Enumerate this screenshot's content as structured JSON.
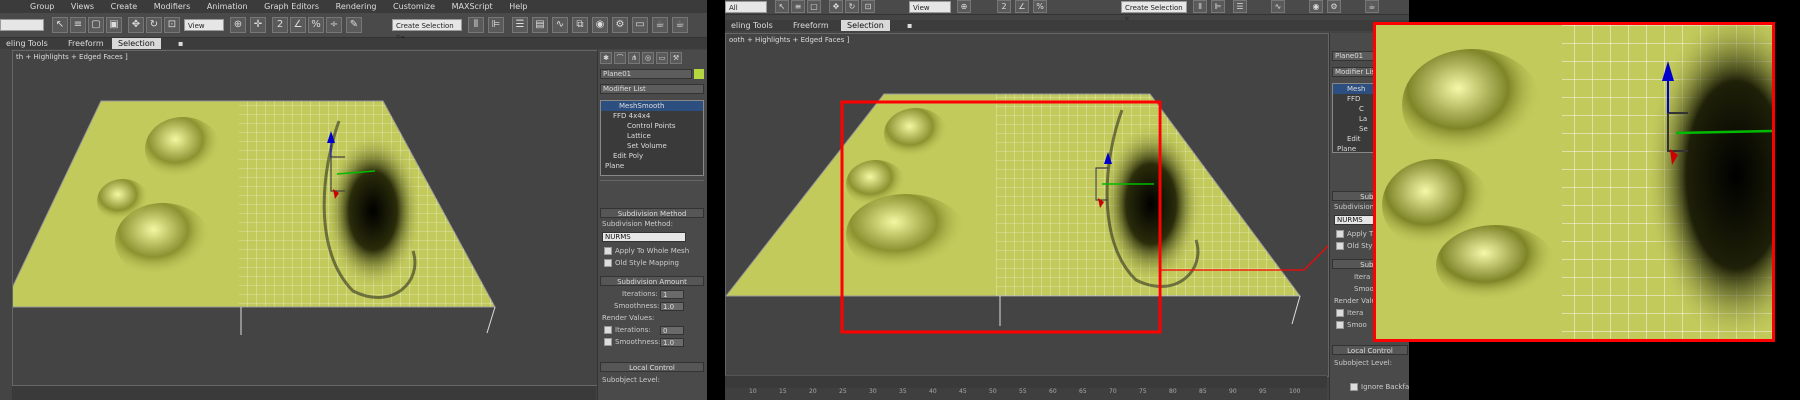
{
  "panel1": {
    "menu": [
      "Group",
      "Views",
      "Create",
      "Modifiers",
      "Animation",
      "Graph Editors",
      "Rendering",
      "Customize",
      "MAXScript",
      "Help"
    ],
    "toolbar": {
      "view_dropdown": "View",
      "selection_set": "Create Selection Se"
    },
    "ribbon": {
      "tabs": [
        "eling Tools",
        "Freeform",
        "Selection"
      ],
      "active_tab": "Selection"
    },
    "viewport_label": "th + Highlights + Edged Faces ]",
    "command_panel": {
      "object_name": "Plane01",
      "modifier_list": "Modifier List",
      "stack": [
        "MeshSmooth",
        "FFD 4x4x4",
        "Control Points",
        "Lattice",
        "Set Volume",
        "Edit Poly",
        "Plane"
      ],
      "rollouts": {
        "subdivision_method": {
          "title": "Subdivision Method",
          "method_label": "Subdivision Method:",
          "method_value": "NURMS",
          "apply_whole_mesh": "Apply To Whole Mesh",
          "old_style_mapping": "Old Style Mapping"
        },
        "subdivision_amount": {
          "title": "Subdivision Amount",
          "iterations_label": "Iterations:",
          "iterations_value": "1",
          "smoothness_label": "Smoothness:",
          "smoothness_value": "1.0",
          "render_values": "Render Values:",
          "render_iterations_label": "Iterations:",
          "render_iterations_value": "0",
          "render_smoothness_label": "Smoothness:",
          "render_smoothness_value": "1.0"
        },
        "local_control": {
          "title": "Local Control",
          "subobject_level": "Subobject Level:"
        }
      }
    }
  },
  "panel2": {
    "toolbar": {
      "all_dropdown": "All",
      "view_dropdown": "View",
      "selection_set": "Create Selection S"
    },
    "ribbon": {
      "tabs": [
        "eling Tools",
        "Freeform",
        "Selection"
      ],
      "active_tab": "Selection"
    },
    "viewport_label": "ooth + Highlights + Edged Faces ]",
    "timeline_ticks": [
      "10",
      "15",
      "20",
      "25",
      "30",
      "35",
      "40",
      "45",
      "50",
      "55",
      "60",
      "65",
      "70",
      "75",
      "80",
      "85",
      "90",
      "95",
      "100"
    ],
    "command_panel": {
      "object_name": "Plane01",
      "modifier_list": "Modifier List",
      "stack_partial": [
        "Mesh",
        "FFD",
        "C",
        "La",
        "Se",
        "Edit",
        "Plane"
      ],
      "rollouts": {
        "subdivision": "Subdi",
        "subdivision_method_label": "Subdivision",
        "method_value": "NURMS",
        "apply": "Apply T",
        "old_style": "Old Style",
        "amount": "Subdi",
        "iterations": "Itera",
        "smoothness": "Smoot",
        "render_values": "Render Valu",
        "render_iterations": "Itera",
        "render_smoothness": "Smoo",
        "local_control": "Local Control",
        "subobject_level": "Subobject Level:",
        "ignore_backface": "Ignore Backface"
      }
    }
  },
  "colors": {
    "mesh": "#c2ca5c",
    "highlight": "#ff0000",
    "ui_bg": "#444444"
  }
}
